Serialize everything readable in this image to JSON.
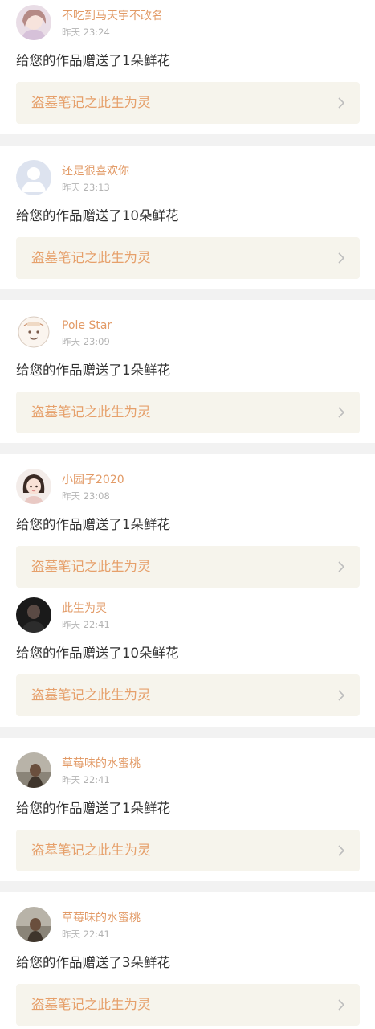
{
  "notifications": [
    {
      "username": "不吃到马天宇不改名",
      "time": "昨天 23:24",
      "message": "给您的作品赠送了1朵鲜花",
      "work_title": "盗墓笔记之此生为灵",
      "avatar": "anime-girl-avatar"
    },
    {
      "username": "还是很喜欢你",
      "time": "昨天 23:13",
      "message": "给您的作品赠送了10朵鲜花",
      "work_title": "盗墓笔记之此生为灵",
      "avatar": "default-user-avatar"
    },
    {
      "username": "Pole Star",
      "time": "昨天 23:09",
      "message": "给您的作品赠送了1朵鲜花",
      "work_title": "盗墓笔记之此生为灵",
      "avatar": "cartoon-sketch-avatar"
    },
    {
      "username": "小园子2020",
      "time": "昨天 23:08",
      "message": "给您的作品赠送了1朵鲜花",
      "work_title": "盗墓笔记之此生为灵",
      "avatar": "cartoon-girl-avatar"
    },
    {
      "username": "此生为灵",
      "time": "昨天 22:41",
      "message": "给您的作品赠送了10朵鲜花",
      "work_title": "盗墓笔记之此生为灵",
      "avatar": "dark-photo-avatar"
    },
    {
      "username": "草莓味的水蜜桃",
      "time": "昨天 22:41",
      "message": "给您的作品赠送了1朵鲜花",
      "work_title": "盗墓笔记之此生为灵",
      "avatar": "photo-avatar"
    },
    {
      "username": "草莓味的水蜜桃",
      "time": "昨天 22:41",
      "message": "给您的作品赠送了3朵鲜花",
      "work_title": "盗墓笔记之此生为灵",
      "avatar": "photo-avatar"
    }
  ],
  "colors": {
    "username": "#e29a66",
    "work_title": "#e6a06b",
    "work_link_bg": "#f6f4ec",
    "separator": "#f2f2f2"
  }
}
